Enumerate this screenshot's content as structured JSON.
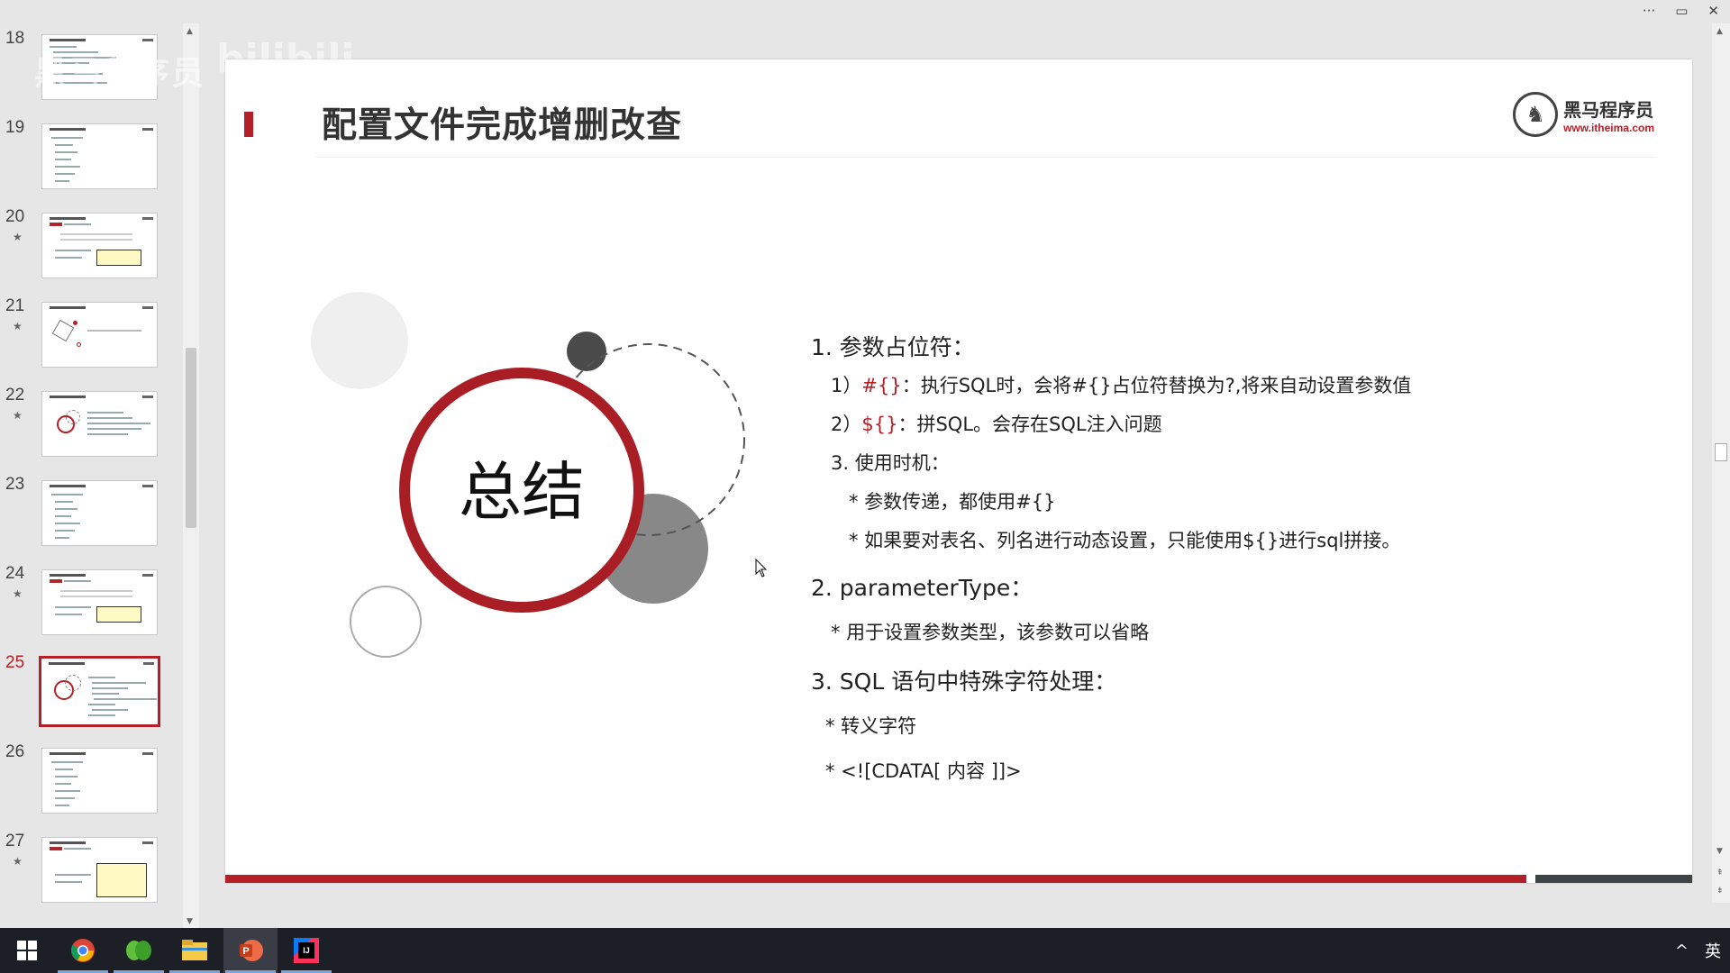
{
  "window": {
    "controls": [
      "···",
      "▭",
      "✕"
    ]
  },
  "thumbnails": [
    {
      "num": "18",
      "star": false,
      "active": false
    },
    {
      "num": "19",
      "star": false,
      "active": false
    },
    {
      "num": "20",
      "star": true,
      "active": false
    },
    {
      "num": "21",
      "star": true,
      "active": false
    },
    {
      "num": "22",
      "star": true,
      "active": false
    },
    {
      "num": "23",
      "star": false,
      "active": false
    },
    {
      "num": "24",
      "star": true,
      "active": false
    },
    {
      "num": "25",
      "star": false,
      "active": true
    },
    {
      "num": "26",
      "star": false,
      "active": false
    },
    {
      "num": "27",
      "star": true,
      "active": false
    }
  ],
  "watermark": {
    "text": "黑马程序员",
    "brand": "bilibili"
  },
  "slide": {
    "title": "配置文件完成增删改查",
    "logo": {
      "cn": "黑马程序员",
      "url": "www.itheima.com"
    },
    "center_label": "总结",
    "lines": [
      {
        "text": "1. 参数占位符：",
        "level": 1,
        "red": "",
        "rest": ""
      },
      {
        "text": "1）",
        "level": 2,
        "red": "#{}",
        "rest": "：执行SQL时，会将#{}占位符替换为?,将来自动设置参数值"
      },
      {
        "text": "2）",
        "level": 2,
        "red": "${}",
        "rest": "：拼SQL。会存在SQL注入问题"
      },
      {
        "text": "3. 使用时机：",
        "level": 2,
        "red": "",
        "rest": ""
      },
      {
        "text": "* 参数传递，都使用#{}",
        "level": 3,
        "red": "",
        "rest": ""
      },
      {
        "text": "* 如果要对表名、列名进行动态设置，只能使用${}进行sql拼接。",
        "level": 3,
        "red": "",
        "rest": ""
      },
      {
        "text": "2. parameterType：",
        "level": 1,
        "red": "",
        "rest": ""
      },
      {
        "text": "* 用于设置参数类型，该参数可以省略",
        "level": 2,
        "red": "",
        "rest": ""
      },
      {
        "text": "3. SQL 语句中特殊字符处理：",
        "level": 1,
        "red": "",
        "rest": ""
      },
      {
        "text": "* 转义字符",
        "level": 2,
        "red": "",
        "rest": ""
      },
      {
        "text": "*  <![CDATA[ 内容 ]]>",
        "level": 2,
        "red": "",
        "rest": ""
      }
    ]
  },
  "taskbar": {
    "apps": [
      "start-icon",
      "chrome-icon",
      "app-green-icon",
      "file-explorer-icon",
      "powerpoint-icon",
      "intellij-icon"
    ],
    "tray": {
      "chevron": "^",
      "ime": "英"
    }
  }
}
